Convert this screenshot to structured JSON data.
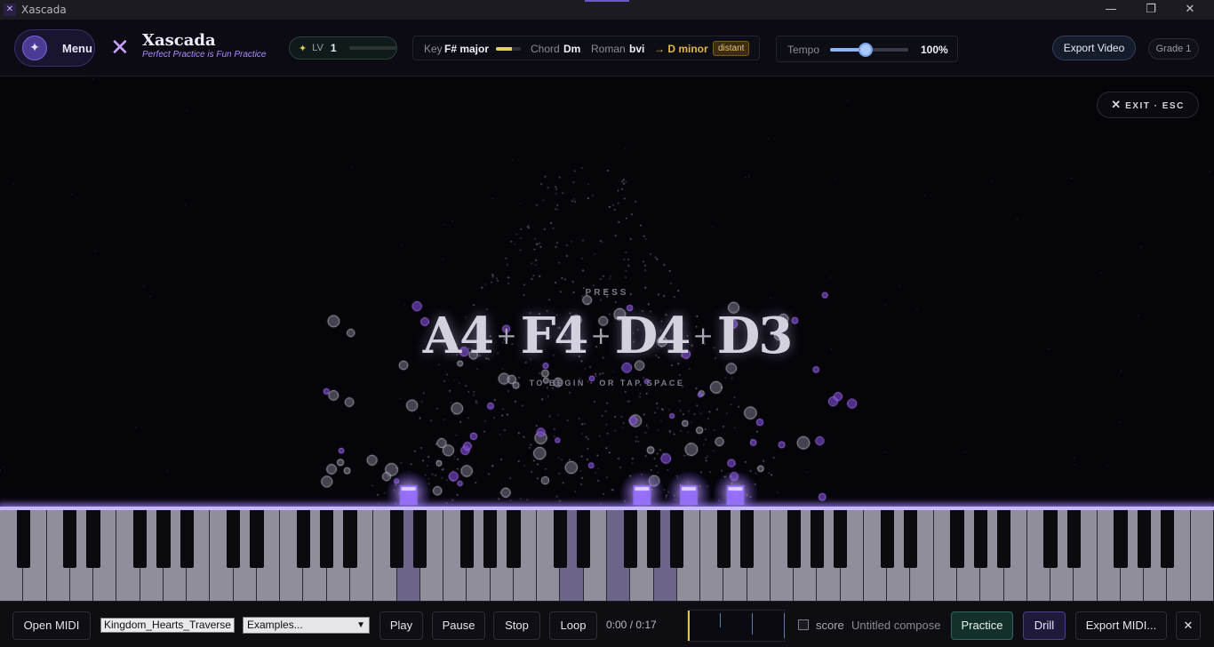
{
  "window": {
    "title": "Xascada"
  },
  "header": {
    "menu_label": "Menu",
    "brand_title": "Xascada",
    "brand_subtitle": "Perfect Practice is Fun Practice",
    "level": {
      "label": "LV",
      "value": "1",
      "progress": 0
    },
    "key_label": "Key",
    "key_value": "F# major",
    "key_strength": 0.65,
    "chord_label": "Chord",
    "chord_value": "Dm",
    "roman_label": "Roman",
    "roman_value": "bvi",
    "modulation": "→ D minor",
    "distance_badge": "distant",
    "tempo_label": "Tempo",
    "tempo_value": "100%",
    "tempo_fraction": 0.45,
    "export_video_label": "Export Video",
    "grade_label": "Grade 1"
  },
  "stage": {
    "exit_label": "EXIT · ESC",
    "press_label": "PRESS",
    "chord_notes": [
      "A4",
      "F4",
      "D4",
      "D3"
    ],
    "tap_label": "TO BEGIN · OR TAP SPACE"
  },
  "piano": {
    "active_keys": [
      "D3",
      "D4",
      "F4",
      "A4"
    ]
  },
  "dock": {
    "open_midi_label": "Open MIDI",
    "file_name": "Kingdom_Hearts_Traverse",
    "examples_label": "Examples...",
    "play_label": "Play",
    "pause_label": "Pause",
    "stop_label": "Stop",
    "loop_label": "Loop",
    "time": "0:00 / 0:17",
    "score_label": "score",
    "compose_name": "Untitled compose",
    "practice_label": "Practice",
    "drill_label": "Drill",
    "export_midi_label": "Export MIDI...",
    "close_symbol": "✕"
  },
  "colors": {
    "accent": "#8b6ff0",
    "glow": "#c8b8ff",
    "key_gold": "#e2b64a",
    "background": "#05040a"
  }
}
